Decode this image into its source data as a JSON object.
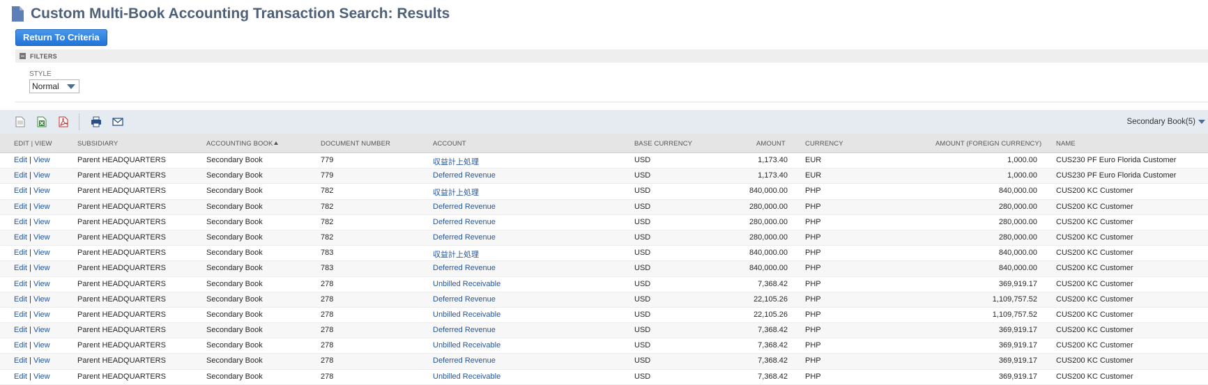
{
  "page": {
    "title": "Custom Multi-Book Accounting Transaction Search: Results"
  },
  "buttons": {
    "return": "Return To Criteria"
  },
  "filters": {
    "header": "FILTERS",
    "style_label": "STYLE",
    "style_value": "Normal"
  },
  "toolbar": {
    "book_selector": "Secondary Book(5)"
  },
  "columns": {
    "edit_view": "EDIT | VIEW",
    "subsidiary": "SUBSIDIARY",
    "accounting_book": "ACCOUNTING BOOK",
    "document_number": "DOCUMENT NUMBER",
    "account": "ACCOUNT",
    "base_currency": "BASE CURRENCY",
    "amount": "AMOUNT",
    "currency": "CURRENCY",
    "amount_foreign": "AMOUNT (FOREIGN CURRENCY)",
    "name": "NAME"
  },
  "row_actions": {
    "edit": "Edit",
    "separator": "|",
    "view": "View"
  },
  "rows": [
    {
      "subsidiary": "Parent HEADQUARTERS",
      "book": "Secondary Book",
      "doc": "779",
      "account": "収益計上処理",
      "base": "USD",
      "amount": "1,173.40",
      "currency": "EUR",
      "amount_fc": "1,000.00",
      "name": "CUS230 PF Euro Florida Customer"
    },
    {
      "subsidiary": "Parent HEADQUARTERS",
      "book": "Secondary Book",
      "doc": "779",
      "account": "Deferred Revenue",
      "base": "USD",
      "amount": "1,173.40",
      "currency": "EUR",
      "amount_fc": "1,000.00",
      "name": "CUS230 PF Euro Florida Customer"
    },
    {
      "subsidiary": "Parent HEADQUARTERS",
      "book": "Secondary Book",
      "doc": "782",
      "account": "収益計上処理",
      "base": "USD",
      "amount": "840,000.00",
      "currency": "PHP",
      "amount_fc": "840,000.00",
      "name": "CUS200 KC Customer"
    },
    {
      "subsidiary": "Parent HEADQUARTERS",
      "book": "Secondary Book",
      "doc": "782",
      "account": "Deferred Revenue",
      "base": "USD",
      "amount": "280,000.00",
      "currency": "PHP",
      "amount_fc": "280,000.00",
      "name": "CUS200 KC Customer"
    },
    {
      "subsidiary": "Parent HEADQUARTERS",
      "book": "Secondary Book",
      "doc": "782",
      "account": "Deferred Revenue",
      "base": "USD",
      "amount": "280,000.00",
      "currency": "PHP",
      "amount_fc": "280,000.00",
      "name": "CUS200 KC Customer"
    },
    {
      "subsidiary": "Parent HEADQUARTERS",
      "book": "Secondary Book",
      "doc": "782",
      "account": "Deferred Revenue",
      "base": "USD",
      "amount": "280,000.00",
      "currency": "PHP",
      "amount_fc": "280,000.00",
      "name": "CUS200 KC Customer"
    },
    {
      "subsidiary": "Parent HEADQUARTERS",
      "book": "Secondary Book",
      "doc": "783",
      "account": "収益計上処理",
      "base": "USD",
      "amount": "840,000.00",
      "currency": "PHP",
      "amount_fc": "840,000.00",
      "name": "CUS200 KC Customer"
    },
    {
      "subsidiary": "Parent HEADQUARTERS",
      "book": "Secondary Book",
      "doc": "783",
      "account": "Deferred Revenue",
      "base": "USD",
      "amount": "840,000.00",
      "currency": "PHP",
      "amount_fc": "840,000.00",
      "name": "CUS200 KC Customer"
    },
    {
      "subsidiary": "Parent HEADQUARTERS",
      "book": "Secondary Book",
      "doc": "278",
      "account": "Unbilled Receivable",
      "base": "USD",
      "amount": "7,368.42",
      "currency": "PHP",
      "amount_fc": "369,919.17",
      "name": "CUS200 KC Customer"
    },
    {
      "subsidiary": "Parent HEADQUARTERS",
      "book": "Secondary Book",
      "doc": "278",
      "account": "Deferred Revenue",
      "base": "USD",
      "amount": "22,105.26",
      "currency": "PHP",
      "amount_fc": "1,109,757.52",
      "name": "CUS200 KC Customer"
    },
    {
      "subsidiary": "Parent HEADQUARTERS",
      "book": "Secondary Book",
      "doc": "278",
      "account": "Unbilled Receivable",
      "base": "USD",
      "amount": "22,105.26",
      "currency": "PHP",
      "amount_fc": "1,109,757.52",
      "name": "CUS200 KC Customer"
    },
    {
      "subsidiary": "Parent HEADQUARTERS",
      "book": "Secondary Book",
      "doc": "278",
      "account": "Deferred Revenue",
      "base": "USD",
      "amount": "7,368.42",
      "currency": "PHP",
      "amount_fc": "369,919.17",
      "name": "CUS200 KC Customer"
    },
    {
      "subsidiary": "Parent HEADQUARTERS",
      "book": "Secondary Book",
      "doc": "278",
      "account": "Unbilled Receivable",
      "base": "USD",
      "amount": "7,368.42",
      "currency": "PHP",
      "amount_fc": "369,919.17",
      "name": "CUS200 KC Customer"
    },
    {
      "subsidiary": "Parent HEADQUARTERS",
      "book": "Secondary Book",
      "doc": "278",
      "account": "Deferred Revenue",
      "base": "USD",
      "amount": "7,368.42",
      "currency": "PHP",
      "amount_fc": "369,919.17",
      "name": "CUS200 KC Customer"
    },
    {
      "subsidiary": "Parent HEADQUARTERS",
      "book": "Secondary Book",
      "doc": "278",
      "account": "Unbilled Receivable",
      "base": "USD",
      "amount": "7,368.42",
      "currency": "PHP",
      "amount_fc": "369,919.17",
      "name": "CUS200 KC Customer"
    }
  ]
}
